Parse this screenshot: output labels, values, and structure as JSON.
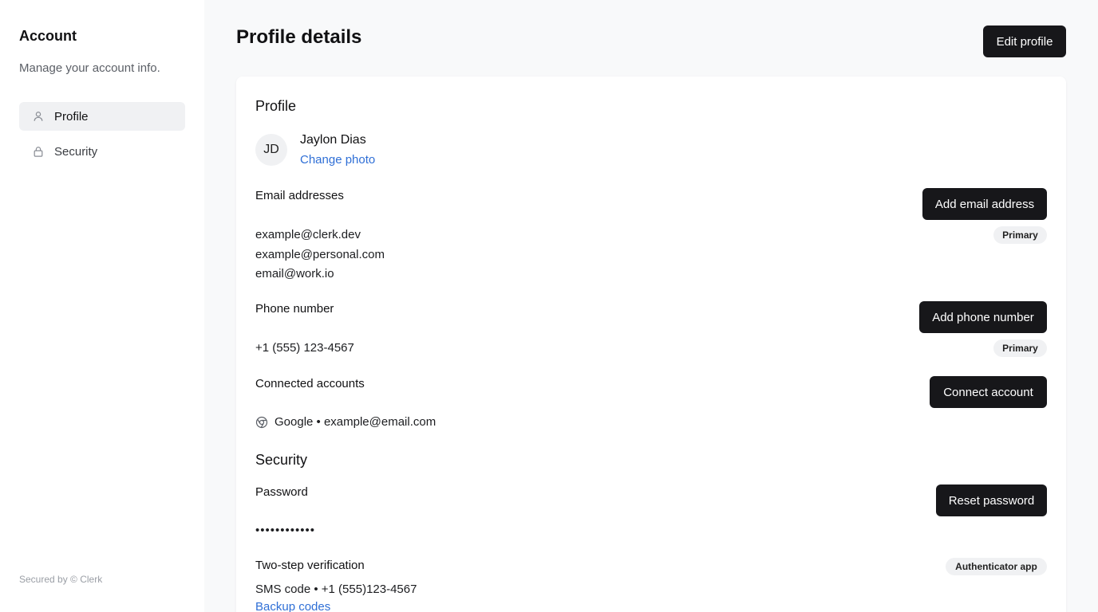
{
  "sidebar": {
    "title": "Account",
    "subtitle": "Manage your account info.",
    "items": [
      {
        "label": "Profile",
        "icon": "user-icon",
        "active": true
      },
      {
        "label": "Security",
        "icon": "lock-icon",
        "active": false
      }
    ],
    "footer": "Secured by © Clerk"
  },
  "header": {
    "title": "Profile details",
    "edit_button": "Edit profile"
  },
  "profile": {
    "section_title": "Profile",
    "avatar_initials": "JD",
    "name": "Jaylon Dias",
    "change_photo": "Change photo"
  },
  "emails": {
    "label": "Email addresses",
    "add_button": "Add email address",
    "primary_badge": "Primary",
    "items": [
      "example@clerk.dev",
      "example@personal.com",
      "email@work.io"
    ]
  },
  "phone": {
    "label": "Phone number",
    "add_button": "Add phone number",
    "primary_badge": "Primary",
    "value": "+1 (555) 123-4567"
  },
  "connected": {
    "label": "Connected accounts",
    "button": "Connect account",
    "account": "Google • example@email.com",
    "icon": "chrome-icon"
  },
  "security": {
    "section_title": "Security",
    "password_label": "Password",
    "reset_button": "Reset password",
    "password_mask": "••••••••••••",
    "two_step_label": "Two-step verification",
    "two_step_badge": "Authenticator app",
    "sms": "SMS code • +1 (555)123-4567",
    "backup_codes": "Backup codes"
  },
  "colors": {
    "accent": "#2f6fd6",
    "button_bg": "#17171a",
    "page_bg": "#f8f9fa"
  }
}
